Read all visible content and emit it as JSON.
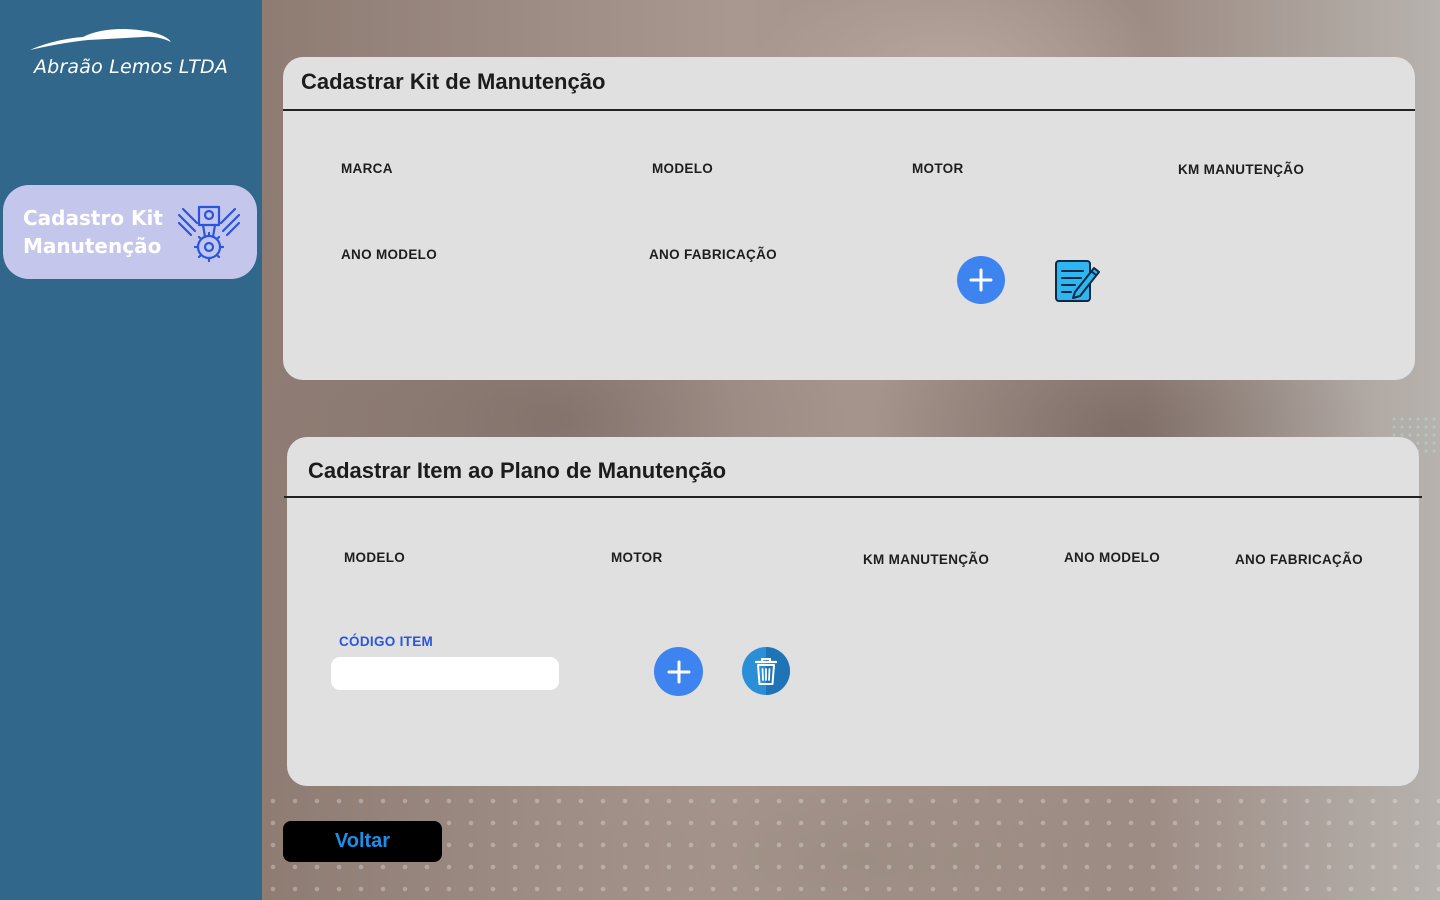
{
  "brand": {
    "name": "Abraão Lemos LTDA",
    "logo_icon": "car-silhouette-icon"
  },
  "sidebar": {
    "items": [
      {
        "label": "Cadastro Kit Manutenção",
        "icon": "engine-piston-icon",
        "active": true
      }
    ]
  },
  "kit_form": {
    "title": "Cadastrar Kit de Manutenção",
    "fields": {
      "marca": "MARCA",
      "modelo": "MODELO",
      "motor": "MOTOR",
      "km_manutencao": "KM MANUTENÇÃO",
      "ano_modelo": "ANO MODELO",
      "ano_fabricacao": "ANO FABRICAÇÃO"
    },
    "actions": {
      "add_icon": "plus-icon",
      "edit_icon": "edit-note-icon"
    }
  },
  "item_form": {
    "title": "Cadastrar Item ao Plano de Manutenção",
    "fields": {
      "modelo": "MODELO",
      "motor": "MOTOR",
      "km_manutencao": "KM MANUTENÇÃO",
      "ano_modelo": "ANO MODELO",
      "ano_fabricacao": "ANO FABRICAÇÃO"
    },
    "codigo_item": {
      "label": "CÓDIGO ITEM",
      "value": "",
      "placeholder": ""
    },
    "actions": {
      "add_icon": "plus-icon",
      "delete_icon": "trash-icon"
    }
  },
  "footer": {
    "back_label": "Voltar"
  },
  "colors": {
    "sidebar": "#30678b",
    "active_item": "#c5c6ec",
    "accent": "#3d84f0",
    "card": "#e0e0e0",
    "code_label": "#2a55e0",
    "back_text": "#1d8fe8"
  }
}
